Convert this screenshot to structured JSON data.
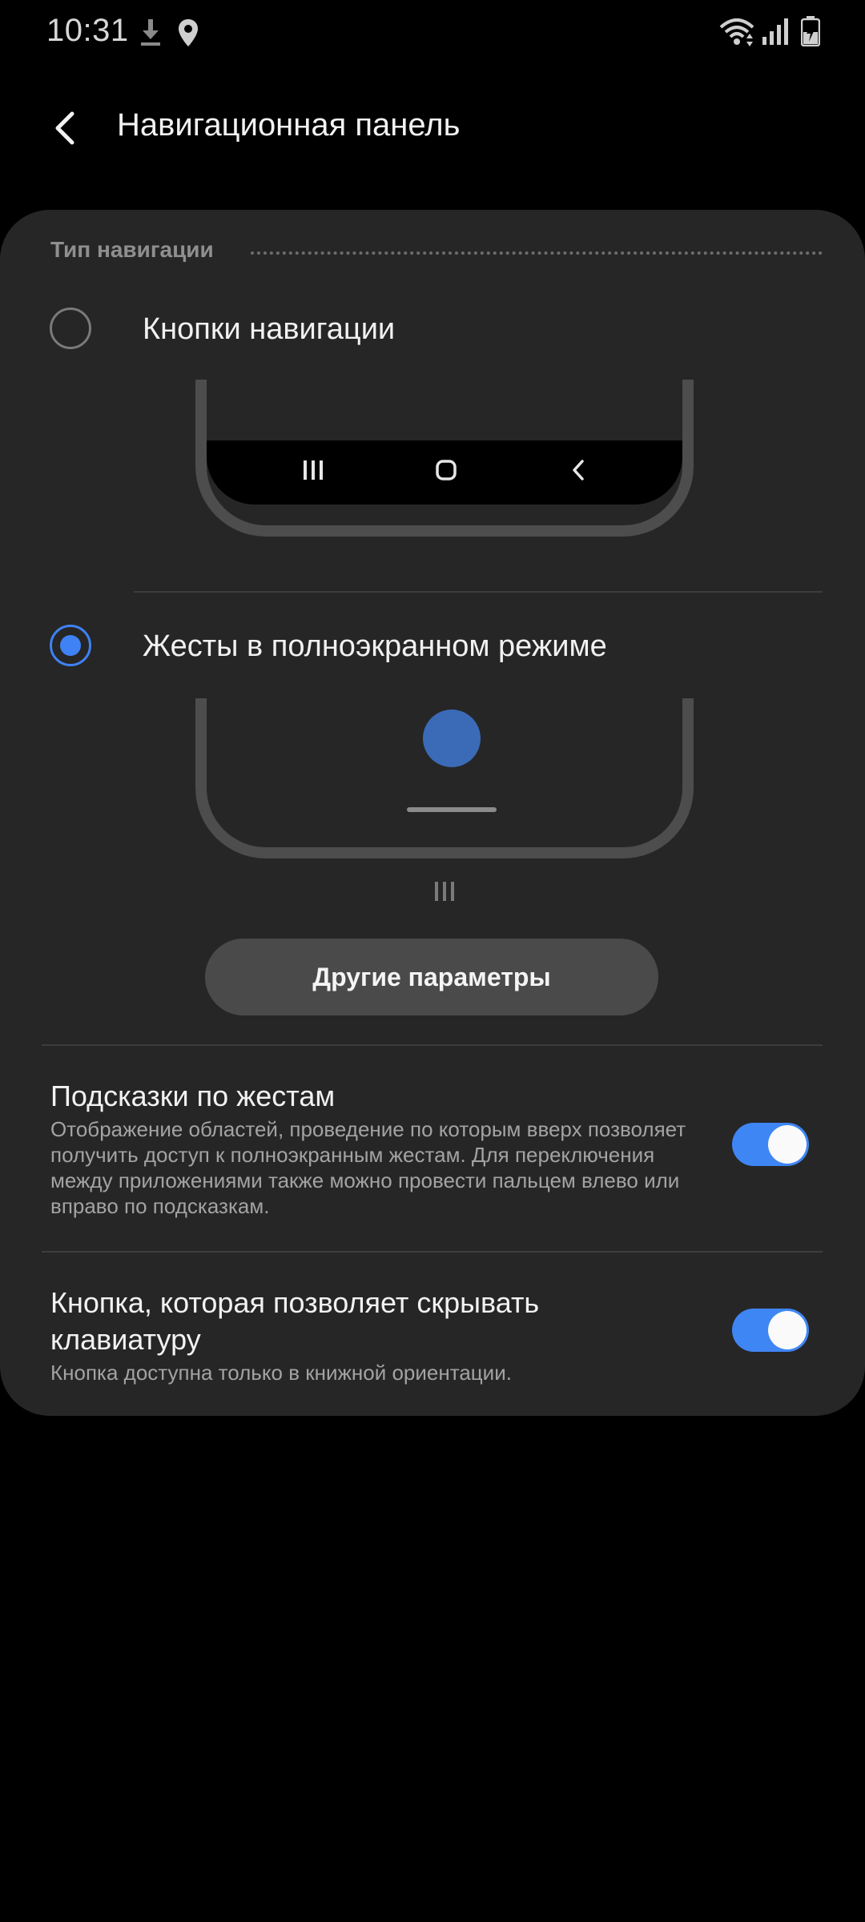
{
  "status_bar": {
    "time": "10:31",
    "icons": [
      "download-icon",
      "location-icon",
      "wifi-icon",
      "signal-icon",
      "battery-charging-icon"
    ]
  },
  "header": {
    "title": "Навигационная панель",
    "back_icon": "chevron-left-icon"
  },
  "section": {
    "label": "Тип навигации"
  },
  "options": [
    {
      "label": "Кнопки навигации",
      "selected": false
    },
    {
      "label": "Жесты в полноэкранном режиме",
      "selected": true
    }
  ],
  "more_button": {
    "label": "Другие параметры"
  },
  "settings": [
    {
      "title": "Подсказки по жестам",
      "description": "Отображение областей, проведение по которым вверх позволяет получить доступ к полноэкранным жестам. Для переключения между приложениями также можно провести пальцем влево или вправо по подсказкам.",
      "enabled": true
    },
    {
      "title": "Кнопка, которая позволяет скрывать клавиатуру",
      "description": "Кнопка доступна только в книжной ориентации.",
      "enabled": true
    }
  ],
  "colors": {
    "accent": "#3f82f5",
    "card_background": "#262626",
    "background": "#000000"
  }
}
